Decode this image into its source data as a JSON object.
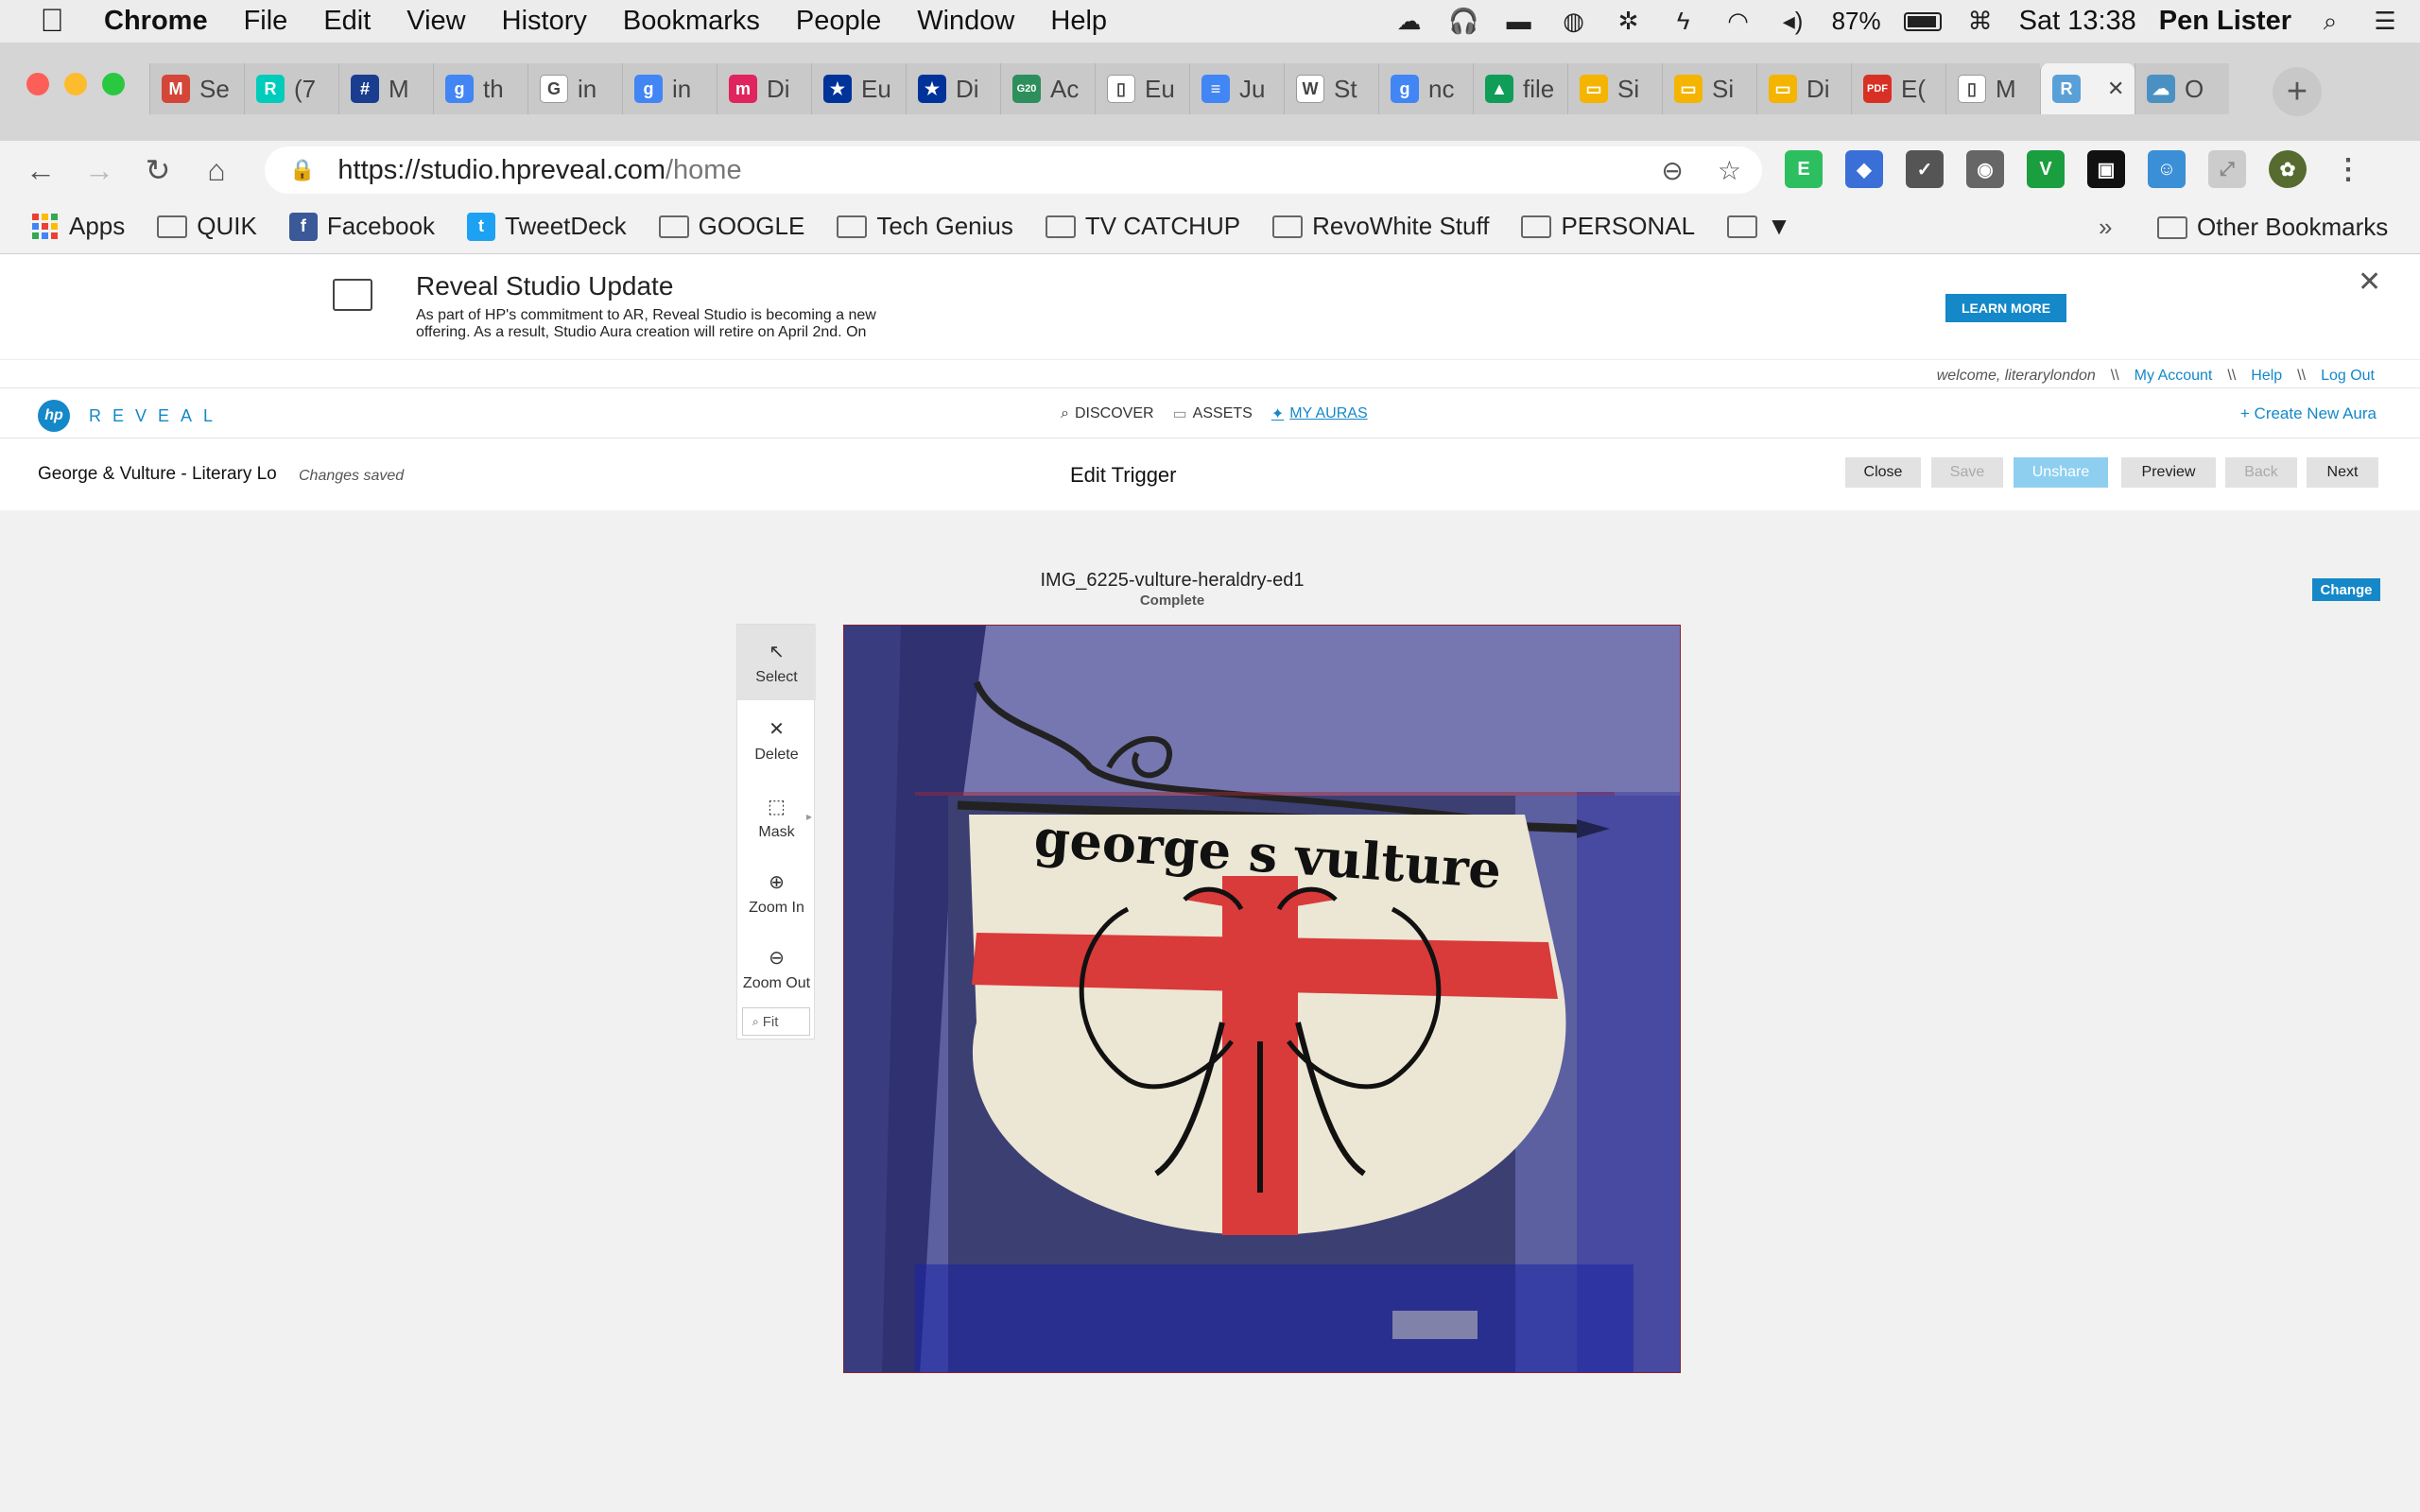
{
  "menubar": {
    "app": "Chrome",
    "items": [
      "File",
      "Edit",
      "View",
      "History",
      "Bookmarks",
      "People",
      "Window",
      "Help"
    ],
    "battery": "87%",
    "clock": "Sat 13:38",
    "user": "Pen Lister"
  },
  "tabs": [
    {
      "label": "Se",
      "icon": "gmail-icon",
      "color": "#d44638",
      "glyph": "M"
    },
    {
      "label": "(7",
      "icon": "researchgate-icon",
      "color": "#00ccbb",
      "glyph": "R"
    },
    {
      "label": "M",
      "icon": "grid-icon",
      "color": "#1a3d8f",
      "glyph": "#"
    },
    {
      "label": "th",
      "icon": "google-scholar-icon",
      "color": "#4285f4",
      "glyph": "g"
    },
    {
      "label": "in",
      "icon": "google-icon",
      "color": "#ffffff",
      "glyph": "G"
    },
    {
      "label": "in",
      "icon": "google-scholar-icon",
      "color": "#4285f4",
      "glyph": "g"
    },
    {
      "label": "Di",
      "icon": "m-icon",
      "color": "#e0245e",
      "glyph": "m"
    },
    {
      "label": "Eu",
      "icon": "eu-flag-icon",
      "color": "#003399",
      "glyph": "★"
    },
    {
      "label": "Di",
      "icon": "eu-flag-icon",
      "color": "#003399",
      "glyph": "★"
    },
    {
      "label": "Ac",
      "icon": "g20-icon",
      "color": "#2d8f5b",
      "glyph": "G20"
    },
    {
      "label": "Eu",
      "icon": "document-icon",
      "color": "#ffffff",
      "glyph": "▯"
    },
    {
      "label": "Ju",
      "icon": "google-docs-icon",
      "color": "#4285f4",
      "glyph": "≡"
    },
    {
      "label": "St",
      "icon": "wikipedia-icon",
      "color": "#ffffff",
      "glyph": "W"
    },
    {
      "label": "nc",
      "icon": "google-scholar-icon",
      "color": "#4285f4",
      "glyph": "g"
    },
    {
      "label": "file",
      "icon": "google-drive-icon",
      "color": "#0f9d58",
      "glyph": "▲"
    },
    {
      "label": "Si",
      "icon": "google-slides-icon",
      "color": "#f4b400",
      "glyph": "▭"
    },
    {
      "label": "Si",
      "icon": "google-slides-icon",
      "color": "#f4b400",
      "glyph": "▭"
    },
    {
      "label": "Di",
      "icon": "google-slides-icon",
      "color": "#f4b400",
      "glyph": "▭"
    },
    {
      "label": "E(",
      "icon": "pdf-icon",
      "color": "#d93025",
      "glyph": "PDF"
    },
    {
      "label": "M",
      "icon": "document-icon",
      "color": "#ffffff",
      "glyph": "▯"
    },
    {
      "label": "",
      "icon": "hp-reveal-icon",
      "color": "#5aa0d8",
      "glyph": "R",
      "active": true
    },
    {
      "label": "O",
      "icon": "landscape-icon",
      "color": "#4a90c2",
      "glyph": "☁"
    }
  ],
  "address": {
    "host": "https://studio.hpreveal.com",
    "path": "/home"
  },
  "bookmarks": [
    {
      "label": "Apps",
      "icon": "apps-grid-icon"
    },
    {
      "label": "QUIK",
      "icon": "folder-icon"
    },
    {
      "label": "Facebook",
      "icon": "facebook-icon"
    },
    {
      "label": "TweetDeck",
      "icon": "tweetdeck-icon"
    },
    {
      "label": "GOOGLE",
      "icon": "folder-icon"
    },
    {
      "label": "Tech Genius",
      "icon": "folder-icon"
    },
    {
      "label": "TV CATCHUP",
      "icon": "folder-icon"
    },
    {
      "label": "RevoWhite Stuff",
      "icon": "folder-icon"
    },
    {
      "label": "PERSONAL",
      "icon": "folder-icon"
    },
    {
      "label": "▼",
      "icon": "folder-icon"
    }
  ],
  "bookmarks_more": "»",
  "bookmarks_other": "Other Bookmarks",
  "banner": {
    "title": "Reveal Studio Update",
    "text": "As part of HP's commitment to AR, Reveal Studio is becoming a new offering. As a result, Studio Aura creation will retire on April 2nd. On",
    "cta": "LEARN MORE"
  },
  "userbar": {
    "welcome": "welcome, literarylondon",
    "sep": "\\\\",
    "account": "My Account",
    "help": "Help",
    "logout": "Log Out"
  },
  "logo": {
    "mark": "hp",
    "word": "REVEAL"
  },
  "mainnav": {
    "discover": "DISCOVER",
    "assets": "ASSETS",
    "my_auras": "MY AURAS",
    "create": "+ Create New Aura"
  },
  "editbar": {
    "project": "George & Vulture - Literary Lo",
    "status": "Changes saved",
    "title": "Edit Trigger",
    "buttons": {
      "close": "Close",
      "save": "Save",
      "unshare": "Unshare",
      "preview": "Preview",
      "back": "Back",
      "next": "Next"
    }
  },
  "trigger": {
    "filename": "IMG_6225-vulture-heraldry-ed1",
    "status": "Complete",
    "change": "Change",
    "sign_text": "george s vulture"
  },
  "tools": {
    "select": "Select",
    "delete": "Delete",
    "mask": "Mask",
    "zoom_in": "Zoom In",
    "zoom_out": "Zoom Out",
    "fit": "Fit"
  }
}
